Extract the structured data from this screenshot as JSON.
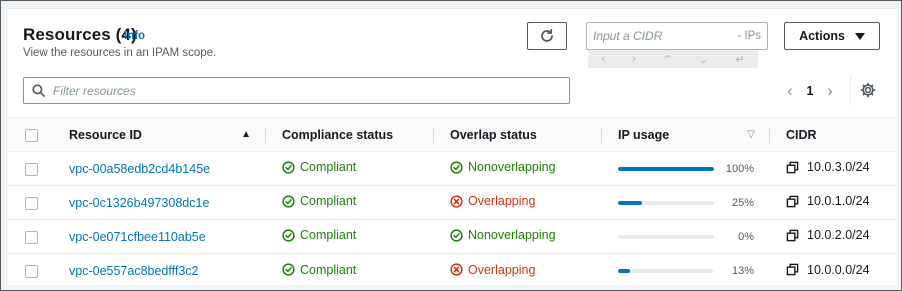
{
  "header": {
    "title": "Resources (4)",
    "info_label": "Info",
    "description": "View the resources in an IPAM scope."
  },
  "toolbar": {
    "refresh_icon": "refresh-icon",
    "cidr_placeholder": "Input a CIDR",
    "cidr_suffix": "- IPs",
    "cidr_nav": [
      "‹",
      "›",
      "⌃",
      "⌄",
      "↵"
    ],
    "actions_label": "Actions"
  },
  "filter": {
    "placeholder": "Filter resources"
  },
  "pagination": {
    "current_page": "1",
    "prev": "‹",
    "next": "›"
  },
  "table": {
    "columns": [
      "Resource ID",
      "Compliance status",
      "Overlap status",
      "IP usage",
      "CIDR"
    ],
    "rows": [
      {
        "resource_id": "vpc-00a58edb2cd4b145e",
        "compliance": "Compliant",
        "overlap": "Nonoverlapping",
        "overlap_ok": true,
        "ip_usage": 1.0,
        "ip_usage_label": "100%",
        "cidr": "10.0.3.0/24"
      },
      {
        "resource_id": "vpc-0c1326b497308dc1e",
        "compliance": "Compliant",
        "overlap": "Overlapping",
        "overlap_ok": false,
        "ip_usage": 0.25,
        "ip_usage_label": "25%",
        "cidr": "10.0.1.0/24"
      },
      {
        "resource_id": "vpc-0e071cfbee110ab5e",
        "compliance": "Compliant",
        "overlap": "Nonoverlapping",
        "overlap_ok": true,
        "ip_usage": 0.0,
        "ip_usage_label": "0%",
        "cidr": "10.0.2.0/24"
      },
      {
        "resource_id": "vpc-0e557ac8bedfff3c2",
        "compliance": "Compliant",
        "overlap": "Overlapping",
        "overlap_ok": false,
        "ip_usage": 0.13,
        "ip_usage_label": "13%",
        "cidr": "10.0.0.0/24"
      }
    ]
  },
  "colors": {
    "link": "#0073bb",
    "success": "#1d8102",
    "error": "#d13212",
    "bar_fill": "#0073bb"
  }
}
